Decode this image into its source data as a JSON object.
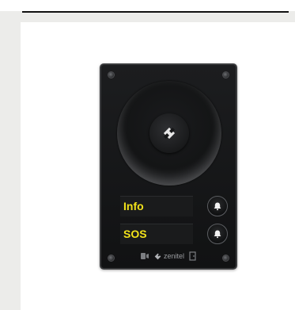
{
  "device": {
    "buttons": [
      {
        "label": "Info"
      },
      {
        "label": "SOS"
      }
    ],
    "brand": "zenitel"
  },
  "colors": {
    "label_text": "#f2e21a",
    "panel": "#151617",
    "background": "#ececea"
  },
  "icons": [
    "bell-icon",
    "speaker-icon",
    "zenitel-logo-icon",
    "camera-icon",
    "door-icon"
  ]
}
